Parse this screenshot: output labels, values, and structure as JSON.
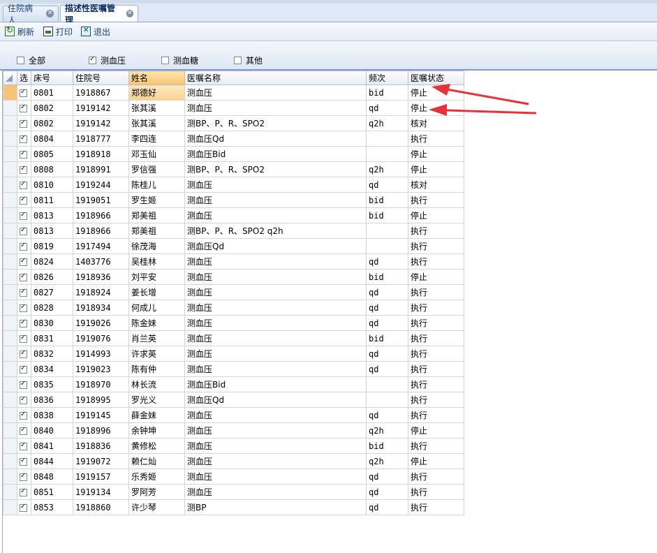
{
  "tabs": [
    {
      "label": "住院病人",
      "active": false
    },
    {
      "label": "描述性医嘱管理",
      "active": true
    }
  ],
  "toolbar": {
    "refresh_label": "刷新",
    "print_label": "打印",
    "exit_label": "退出"
  },
  "filters": [
    {
      "label": "全部",
      "checked": false
    },
    {
      "label": "测血压",
      "checked": true
    },
    {
      "label": "测血糖",
      "checked": false
    },
    {
      "label": "其他",
      "checked": false
    }
  ],
  "grid": {
    "columns": [
      "选",
      "床号",
      "住院号",
      "姓名",
      "医嘱名称",
      "频次",
      "医嘱状态"
    ],
    "rows": [
      {
        "bed": "0801",
        "id": "1918867",
        "name": "郑德好",
        "order": "测血压",
        "freq": "bid",
        "status": "停止"
      },
      {
        "bed": "0802",
        "id": "1919142",
        "name": "张其溪",
        "order": "测血压",
        "freq": "qd",
        "status": "停止"
      },
      {
        "bed": "0802",
        "id": "1919142",
        "name": "张其溪",
        "order": "测BP、P、R、SPO2",
        "freq": "q2h",
        "status": "核对"
      },
      {
        "bed": "0804",
        "id": "1918777",
        "name": "李四连",
        "order": "测血压Qd",
        "freq": "",
        "status": "执行"
      },
      {
        "bed": "0805",
        "id": "1918918",
        "name": "邓玉仙",
        "order": "测血压Bid",
        "freq": "",
        "status": "停止"
      },
      {
        "bed": "0808",
        "id": "1918991",
        "name": "罗信强",
        "order": "测BP、P、R、SPO2",
        "freq": "q2h",
        "status": "停止"
      },
      {
        "bed": "0810",
        "id": "1919244",
        "name": "陈桂儿",
        "order": "测血压",
        "freq": "qd",
        "status": "核对"
      },
      {
        "bed": "0811",
        "id": "1919051",
        "name": "罗生姬",
        "order": "测血压",
        "freq": "bid",
        "status": "执行"
      },
      {
        "bed": "0813",
        "id": "1918966",
        "name": "郑美祖",
        "order": "测血压",
        "freq": "bid",
        "status": "停止"
      },
      {
        "bed": "0813",
        "id": "1918966",
        "name": "郑美祖",
        "order": "测BP、P、R、SPO2  q2h",
        "freq": "",
        "status": "执行"
      },
      {
        "bed": "0819",
        "id": "1917494",
        "name": "徐茂海",
        "order": "测血压Qd",
        "freq": "",
        "status": "执行"
      },
      {
        "bed": "0824",
        "id": "1403776",
        "name": "吴桂林",
        "order": "测血压",
        "freq": "qd",
        "status": "执行"
      },
      {
        "bed": "0826",
        "id": "1918936",
        "name": "刘平安",
        "order": "测血压",
        "freq": "bid",
        "status": "停止"
      },
      {
        "bed": "0827",
        "id": "1918924",
        "name": "姜长增",
        "order": "测血压",
        "freq": "qd",
        "status": "执行"
      },
      {
        "bed": "0828",
        "id": "1918934",
        "name": "何成儿",
        "order": "测血压",
        "freq": "qd",
        "status": "执行"
      },
      {
        "bed": "0830",
        "id": "1919026",
        "name": "陈金妹",
        "order": "测血压",
        "freq": "qd",
        "status": "执行"
      },
      {
        "bed": "0831",
        "id": "1919076",
        "name": "肖兰英",
        "order": "测血压",
        "freq": "bid",
        "status": "执行"
      },
      {
        "bed": "0832",
        "id": "1914993",
        "name": "许求英",
        "order": "测血压",
        "freq": "qd",
        "status": "执行"
      },
      {
        "bed": "0834",
        "id": "1919023",
        "name": "陈有仲",
        "order": "测血压",
        "freq": "qd",
        "status": "执行"
      },
      {
        "bed": "0835",
        "id": "1918970",
        "name": "林长流",
        "order": "测血压Bid",
        "freq": "",
        "status": "执行"
      },
      {
        "bed": "0836",
        "id": "1918995",
        "name": "罗光义",
        "order": "测血压Qd",
        "freq": "",
        "status": "执行"
      },
      {
        "bed": "0838",
        "id": "1919145",
        "name": "薛金妹",
        "order": "测血压",
        "freq": "qd",
        "status": "执行"
      },
      {
        "bed": "0840",
        "id": "1918996",
        "name": "余钟坤",
        "order": "测血压",
        "freq": "q2h",
        "status": "停止"
      },
      {
        "bed": "0841",
        "id": "1918836",
        "name": "黄修松",
        "order": "测血压",
        "freq": "bid",
        "status": "执行"
      },
      {
        "bed": "0844",
        "id": "1919072",
        "name": "赖仁灿",
        "order": "测血压",
        "freq": "q2h",
        "status": "停止"
      },
      {
        "bed": "0848",
        "id": "1919157",
        "name": "乐秀姬",
        "order": "测血压",
        "freq": "qd",
        "status": "执行"
      },
      {
        "bed": "0851",
        "id": "1919134",
        "name": "罗阿芳",
        "order": "测血压",
        "freq": "qd",
        "status": "执行"
      },
      {
        "bed": "0853",
        "id": "1918860",
        "name": "许少琴",
        "order": "测BP",
        "freq": "qd",
        "status": "执行"
      }
    ]
  },
  "annotations": {
    "arrow_color": "#e8323a",
    "arrow_targets": [
      "row 1 status",
      "row 2 status"
    ]
  }
}
